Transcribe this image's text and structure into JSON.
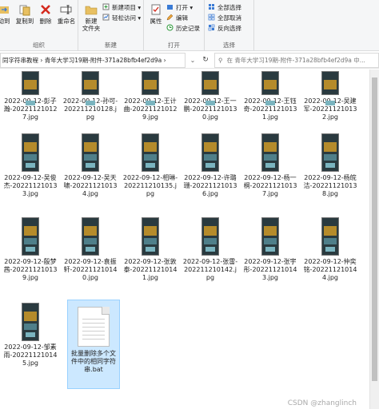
{
  "ribbon": {
    "organize": {
      "label": "组织",
      "move_to": "动到",
      "copy_to": "复制到",
      "delete": "删除",
      "rename": "重命名"
    },
    "new": {
      "label": "新建",
      "new_folder": "新建\n文件夹",
      "new_item": "新建项目 ▾",
      "easy_access": "轻松访问 ▾"
    },
    "open": {
      "label": "打开",
      "properties": "属性",
      "open": "打开 ▾",
      "edit": "编辑",
      "history": "历史记录"
    },
    "select": {
      "label": "选择",
      "select_all": "全部选择",
      "select_none": "全部取消",
      "invert": "反向选择"
    }
  },
  "address": {
    "path": "同字符串教程 › 青年大学习19期-附件-371a28bfb4ef2d9a ›",
    "dropdown": "⌄",
    "refresh": "↻",
    "search_placeholder": "在 青年大学习19期-附件-371a28bfb4ef2d9a 中..."
  },
  "files": [
    {
      "name": "2022-09-12-彭子瀚-202211210127.jpg"
    },
    {
      "name": "2022-09-12-孙可-202211210128.jpg"
    },
    {
      "name": "2022-09-12-王计曲-202211210129.jpg"
    },
    {
      "name": "2022-09-12-王一鹏-202211210130.jpg"
    },
    {
      "name": "2022-09-12-王钰奇-202211210131.jpg"
    },
    {
      "name": "2022-09-12-吴建军-202211210132.jpg"
    },
    {
      "name": "2022-09-12-吴俊杰-202211210133.jpg"
    },
    {
      "name": "2022-09-12-吴天啸-202211210134.jpg"
    },
    {
      "name": "2022-09-12-相琳-202211210135.jpg"
    },
    {
      "name": "2022-09-12-许璐珊-202211210136.jpg"
    },
    {
      "name": "2022-09-12-杨一桐-202211210137.jpg"
    },
    {
      "name": "2022-09-12-杨皖洁-202211210138.jpg"
    },
    {
      "name": "2022-09-12-殷梦茜-202211210139.jpg"
    },
    {
      "name": "2022-09-12-袁振轩-202211210140.jpg"
    },
    {
      "name": "2022-09-12-张敦泰-202211210141.jpg"
    },
    {
      "name": "2022-09-12-张雷-202211210142.jpg"
    },
    {
      "name": "2022-09-12-张宇彤-202211210143.jpg"
    },
    {
      "name": "2022-09-12-仲奕铭-202211210144.jpg"
    },
    {
      "name": "2022-09-12-邹素雨-202211210145.jpg"
    }
  ],
  "bat_file": {
    "name": "批量删除多个文件中的相同字符串.bat"
  },
  "watermark": "CSDN @zhanglinch",
  "colors": {
    "selection": "#cce8ff",
    "ribbon_bg": "#f5f6f7"
  }
}
